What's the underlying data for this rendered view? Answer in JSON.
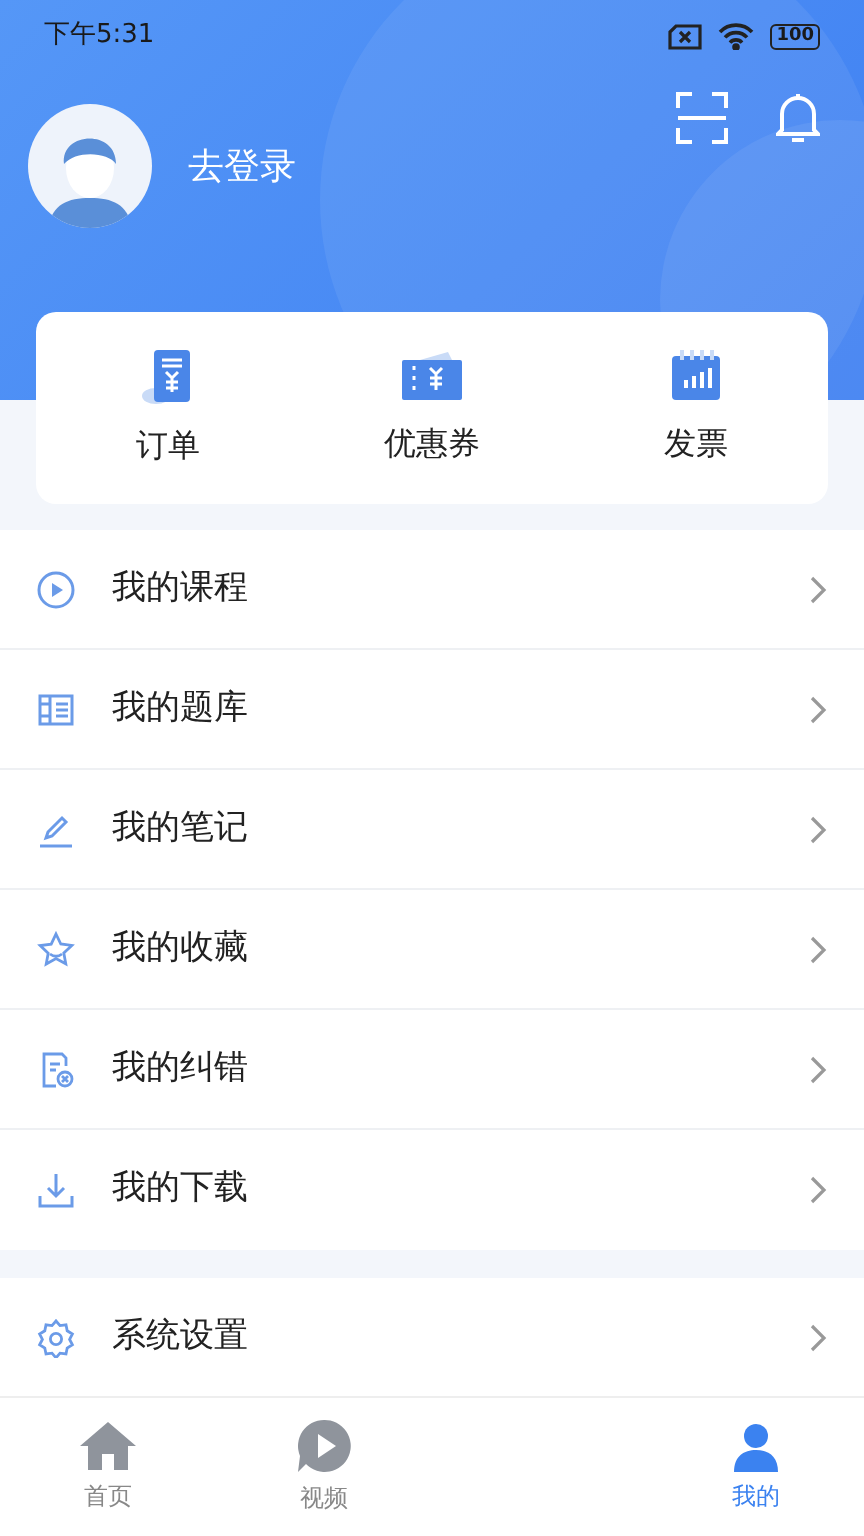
{
  "status_bar": {
    "time": "下午5:31",
    "battery": "100"
  },
  "profile": {
    "login_label": "去登录"
  },
  "shortcuts": [
    {
      "kind": "order",
      "label": "订单"
    },
    {
      "kind": "coupon",
      "label": "优惠券"
    },
    {
      "kind": "invoice",
      "label": "发票"
    }
  ],
  "menu": [
    {
      "kind": "course",
      "label": "我的课程"
    },
    {
      "kind": "questions",
      "label": "我的题库"
    },
    {
      "kind": "notes",
      "label": "我的笔记"
    },
    {
      "kind": "favorites",
      "label": "我的收藏"
    },
    {
      "kind": "errata",
      "label": "我的纠错"
    },
    {
      "kind": "download",
      "label": "我的下载"
    }
  ],
  "settings_menu": [
    {
      "kind": "settings",
      "label": "系统设置"
    }
  ],
  "tab_bar": [
    {
      "kind": "home",
      "label": "首页",
      "selected": false
    },
    {
      "kind": "video",
      "label": "视频",
      "selected": false
    },
    {
      "kind": "me",
      "label": "我的",
      "selected": true
    }
  ]
}
